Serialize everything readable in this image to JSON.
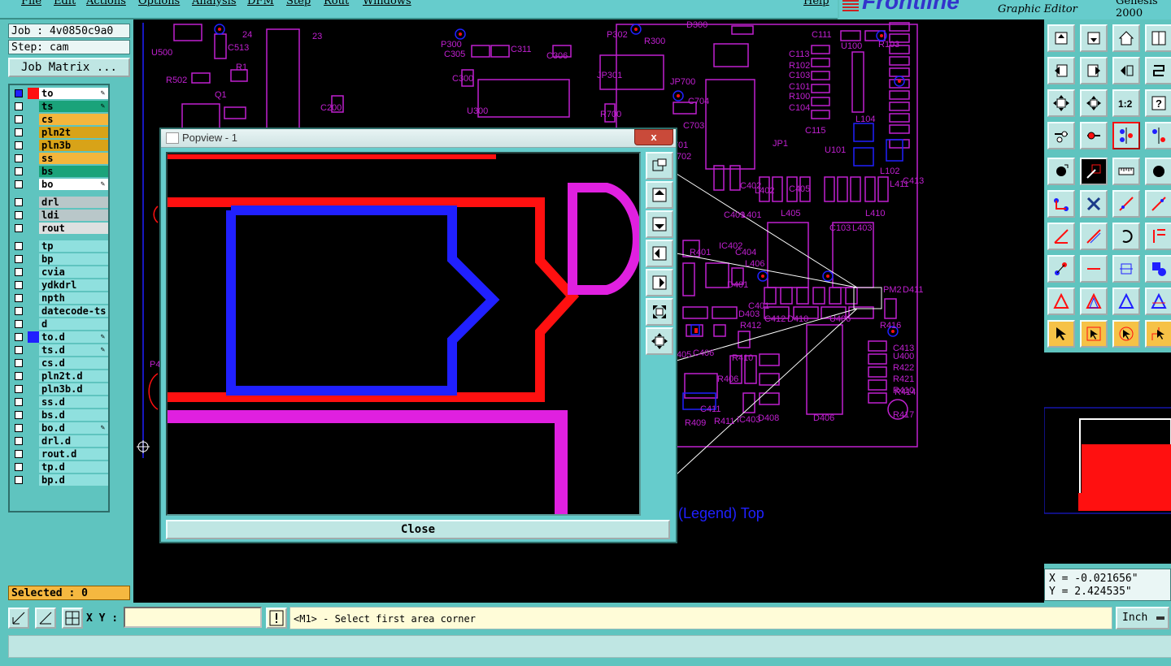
{
  "menu": [
    "File",
    "Edit",
    "Actions",
    "Options",
    "Analysis",
    "DFM",
    "Step",
    "Rout",
    "Windows",
    "Help"
  ],
  "brand": {
    "logo": "Frontline",
    "subtitle": "Graphic Editor",
    "version": "Genesis 2000"
  },
  "job": {
    "job": "Job : 4v0850c9a0",
    "step": "Step: cam",
    "matrix_button": "Job Matrix ..."
  },
  "layers": [
    {
      "name": "to",
      "color": "#ffffff",
      "swatch": "#ff1010",
      "checked": true,
      "selected": true
    },
    {
      "name": "ts",
      "color": "#1aa37a",
      "swatch": "",
      "checked": false,
      "selected": true
    },
    {
      "name": "cs",
      "color": "#f4b63c",
      "swatch": "",
      "checked": false,
      "selected": false
    },
    {
      "name": "pln2t",
      "color": "#d8a318",
      "swatch": "",
      "checked": false,
      "selected": false
    },
    {
      "name": "pln3b",
      "color": "#d8a318",
      "swatch": "",
      "checked": false,
      "selected": false
    },
    {
      "name": "ss",
      "color": "#f4b63c",
      "swatch": "",
      "checked": false,
      "selected": false
    },
    {
      "name": "bs",
      "color": "#1aa37a",
      "swatch": "",
      "checked": false,
      "selected": false
    },
    {
      "name": "bo",
      "color": "#ffffff",
      "swatch": "",
      "checked": false,
      "selected": true
    },
    {
      "name": "drl",
      "color": "#b9c7c9",
      "swatch": "",
      "checked": false,
      "selected": false
    },
    {
      "name": "ldi",
      "color": "#b9c7c9",
      "swatch": "",
      "checked": false,
      "selected": false
    },
    {
      "name": "rout",
      "color": "#dde0e0",
      "swatch": "",
      "checked": false,
      "selected": false
    },
    {
      "name": "tp",
      "color": "#8fe0de",
      "swatch": "",
      "checked": false,
      "selected": false
    },
    {
      "name": "bp",
      "color": "#8fe0de",
      "swatch": "",
      "checked": false,
      "selected": false
    },
    {
      "name": "cvia",
      "color": "#8fe0de",
      "swatch": "",
      "checked": false,
      "selected": false
    },
    {
      "name": "ydkdrl",
      "color": "#8fe0de",
      "swatch": "",
      "checked": false,
      "selected": false
    },
    {
      "name": "npth",
      "color": "#8fe0de",
      "swatch": "",
      "checked": false,
      "selected": false
    },
    {
      "name": "datecode-ts",
      "color": "#8fe0de",
      "swatch": "",
      "checked": false,
      "selected": false
    },
    {
      "name": "d",
      "color": "#8fe0de",
      "swatch": "",
      "checked": false,
      "selected": false
    },
    {
      "name": "to.d",
      "color": "#8fe0de",
      "swatch": "#2020ff",
      "checked": false,
      "selected": true
    },
    {
      "name": "ts.d",
      "color": "#8fe0de",
      "swatch": "",
      "checked": false,
      "selected": true
    },
    {
      "name": "cs.d",
      "color": "#8fe0de",
      "swatch": "",
      "checked": false,
      "selected": false
    },
    {
      "name": "pln2t.d",
      "color": "#8fe0de",
      "swatch": "",
      "checked": false,
      "selected": false
    },
    {
      "name": "pln3b.d",
      "color": "#8fe0de",
      "swatch": "",
      "checked": false,
      "selected": false
    },
    {
      "name": "ss.d",
      "color": "#8fe0de",
      "swatch": "",
      "checked": false,
      "selected": false
    },
    {
      "name": "bs.d",
      "color": "#8fe0de",
      "swatch": "",
      "checked": false,
      "selected": false
    },
    {
      "name": "bo.d",
      "color": "#8fe0de",
      "swatch": "",
      "checked": false,
      "selected": true
    },
    {
      "name": "drl.d",
      "color": "#8fe0de",
      "swatch": "",
      "checked": false,
      "selected": false
    },
    {
      "name": "rout.d",
      "color": "#8fe0de",
      "swatch": "",
      "checked": false,
      "selected": false
    },
    {
      "name": "tp.d",
      "color": "#8fe0de",
      "swatch": "",
      "checked": false,
      "selected": false
    },
    {
      "name": "bp.d",
      "color": "#8fe0de",
      "swatch": "",
      "checked": false,
      "selected": false
    }
  ],
  "selected": "Selected : 0",
  "popview": {
    "title": "Popview - 1",
    "close_x": "x",
    "close_button": "Close"
  },
  "canvas": {
    "legend": "(Legend) Top",
    "refs": [
      "U500",
      "24",
      "23",
      "C513",
      "R502",
      "R1",
      "Q1",
      "C200",
      "P300",
      "C305",
      "C311",
      "C306",
      "C300",
      "U300",
      "P302",
      "R300",
      "D300",
      "JP301",
      "R700",
      "JP700",
      "C704",
      "C703",
      "U701",
      "C702",
      "IC402",
      "C402",
      "L402",
      "C409",
      "L401",
      "C405",
      "L405",
      "JP1",
      "C111",
      "U100",
      "R103",
      "C113",
      "R102",
      "C103",
      "C101",
      "R100",
      "C104",
      "C115",
      "L104",
      "L102",
      "L411",
      "C413",
      "L410",
      "U101",
      "C103",
      "L403",
      "L406",
      "C401",
      "R401",
      "C404",
      "D401",
      "D403",
      "R412",
      "C412",
      "D410",
      "D405",
      "C406",
      "R406",
      "R410",
      "R409",
      "R411",
      "IC403",
      "D408",
      "D406",
      "D411",
      "C413",
      "U400",
      "R422",
      "R421",
      "R410",
      "R414",
      "R417",
      "R416",
      "PM2",
      "P408",
      "U406",
      "B",
      "C411"
    ]
  },
  "coords": {
    "x": "X = -0.021656\"",
    "y": "Y = 2.424535\""
  },
  "bottom": {
    "xy_label": "X Y :",
    "prompt": "<M1> - Select first area corner",
    "units": "Inch"
  },
  "colors": {
    "background": "#5fc4bf",
    "canvas": "#000000",
    "silk": "#e020e0",
    "copper_red": "#ff1010",
    "copper_blue": "#2020ff",
    "selected_bg": "#f5b840"
  },
  "icons": [
    "zoom-in-icon",
    "zoom-out-icon",
    "home-icon",
    "grid-icon",
    "pan-left-icon",
    "pan-right-icon",
    "undo-icon",
    "redo-icon",
    "fit-icon",
    "center-icon",
    "scale-1-2-icon",
    "help-icon",
    "measure-icon",
    "snap-icon",
    "ruler-icon",
    "pad-icon",
    "select-arrow-icon"
  ]
}
